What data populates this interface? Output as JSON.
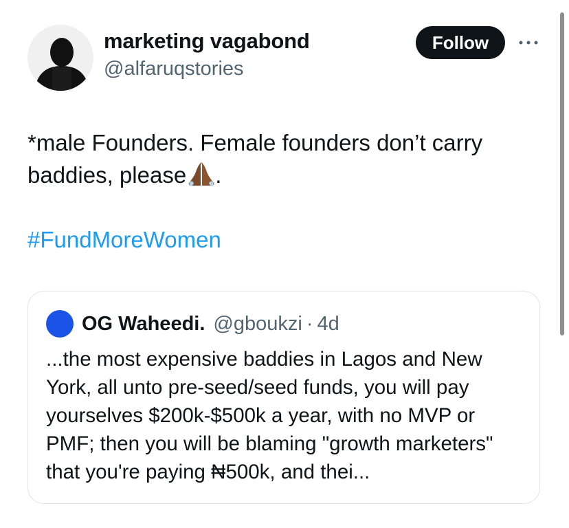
{
  "author": {
    "display_name": "marketing vagabond",
    "handle": "@alfaruqstories",
    "avatar_icon": "silhouette-avatar"
  },
  "follow_button": {
    "label": "Follow"
  },
  "more_button": {
    "icon": "more-options-icon"
  },
  "tweet": {
    "text": "*male Founders. Female founders don’t carry baddies, please",
    "emoji": "folded-hands-icon",
    "text_end": ".",
    "hashtag": "#FundMoreWomen"
  },
  "quote": {
    "display_name": "OG Waheedi.",
    "handle": "@gboukzi",
    "separator": "·",
    "time": "4d",
    "avatar_color": "#1a53e6",
    "text": "...the most expensive baddies in Lagos and New York, all unto pre-seed/seed funds, you will pay yourselves $200k-$500k a year, with no MVP or PMF; then you will be blaming \"growth marketers\" that you're paying ₦500k, and thei..."
  },
  "colors": {
    "link": "#1d9bf0",
    "secondary_text": "#536471",
    "primary_text": "#0f1419",
    "button_bg": "#0f1419"
  }
}
